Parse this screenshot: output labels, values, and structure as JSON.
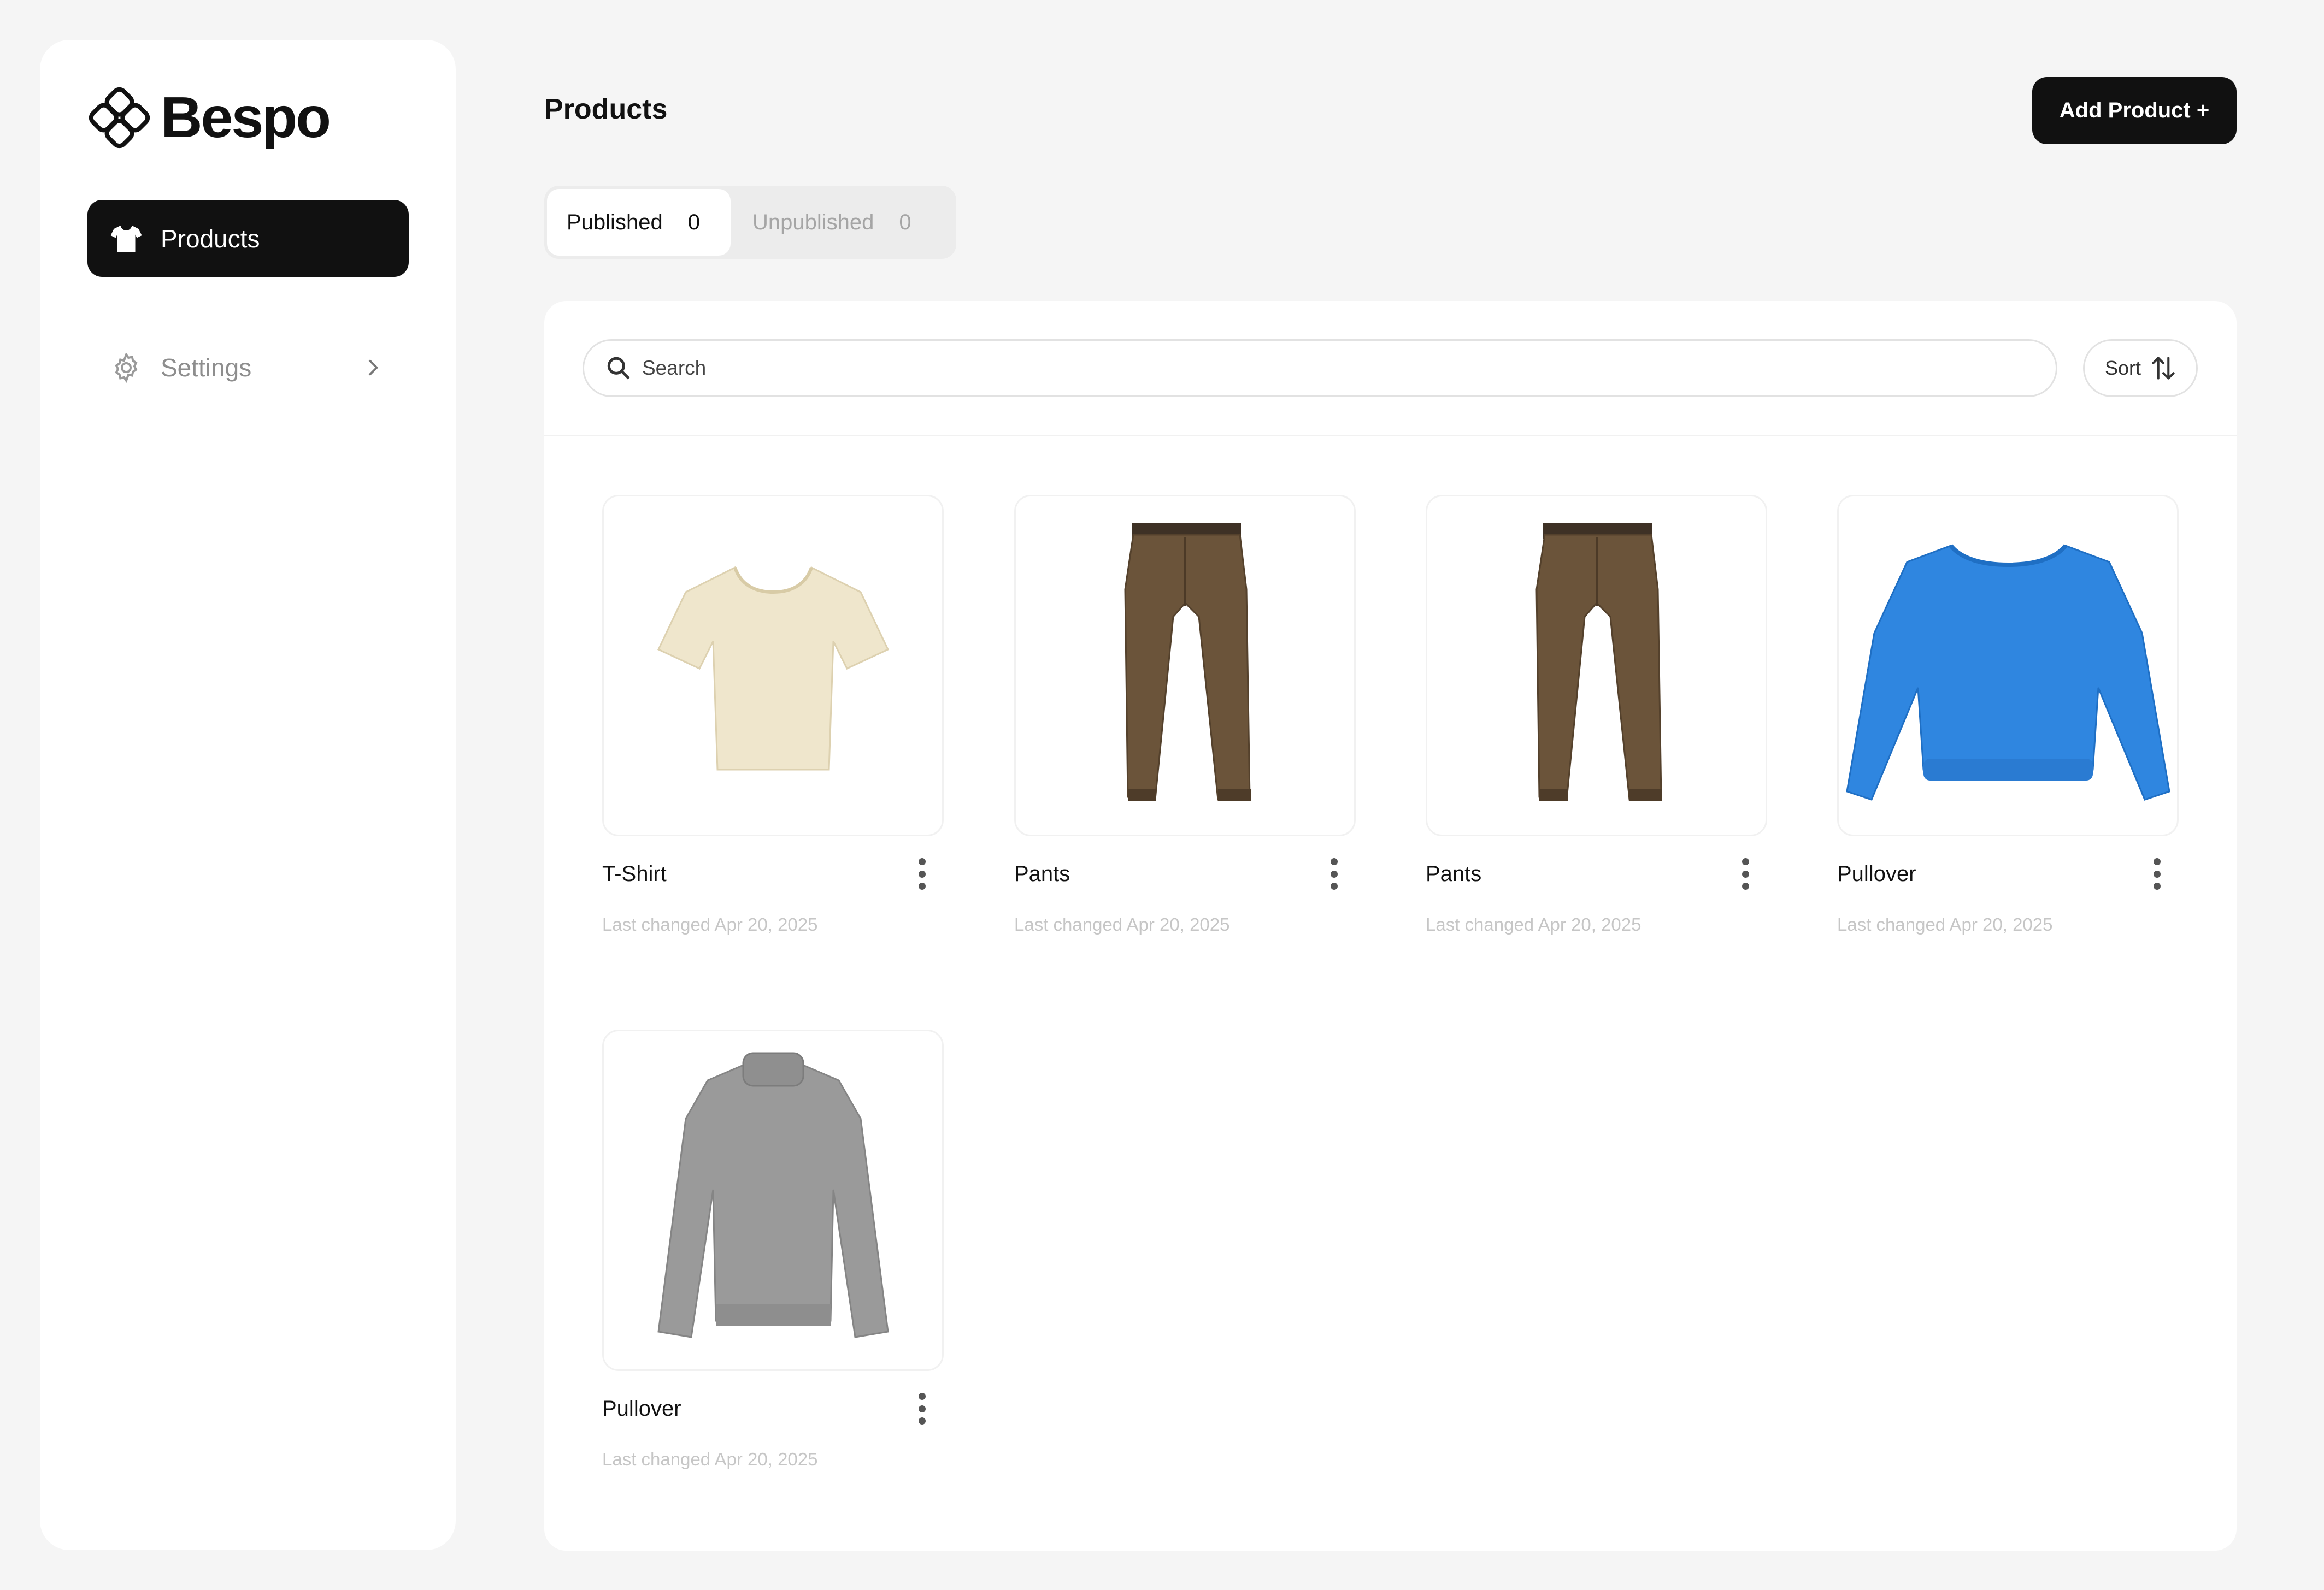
{
  "brand": {
    "name": "Bespo"
  },
  "sidebar": {
    "items": [
      {
        "label": "Products",
        "icon": "tshirt-icon"
      },
      {
        "label": "Settings",
        "icon": "gear-icon"
      }
    ]
  },
  "header": {
    "title": "Products",
    "add_button": "Add Product +"
  },
  "tabs": [
    {
      "label": "Published",
      "count": "0"
    },
    {
      "label": "Unpublished",
      "count": "0"
    }
  ],
  "search": {
    "placeholder": "Search"
  },
  "sort": {
    "label": "Sort"
  },
  "products": [
    {
      "name": "T-Shirt",
      "changed": "Last changed Apr 20, 2025",
      "image": "cream-tshirt"
    },
    {
      "name": "Pants",
      "changed": "Last changed Apr 20, 2025",
      "image": "brown-pants"
    },
    {
      "name": "Pants",
      "changed": "Last changed Apr 20, 2025",
      "image": "brown-pants"
    },
    {
      "name": "Pullover",
      "changed": "Last changed Apr 20, 2025",
      "image": "blue-sweatshirt"
    },
    {
      "name": "Pullover",
      "changed": "Last changed Apr 20, 2025",
      "image": "gray-turtleneck-sweater"
    }
  ],
  "colors": {
    "accent": "#111111",
    "background": "#f5f5f5",
    "muted_text": "#c6c6c6"
  }
}
